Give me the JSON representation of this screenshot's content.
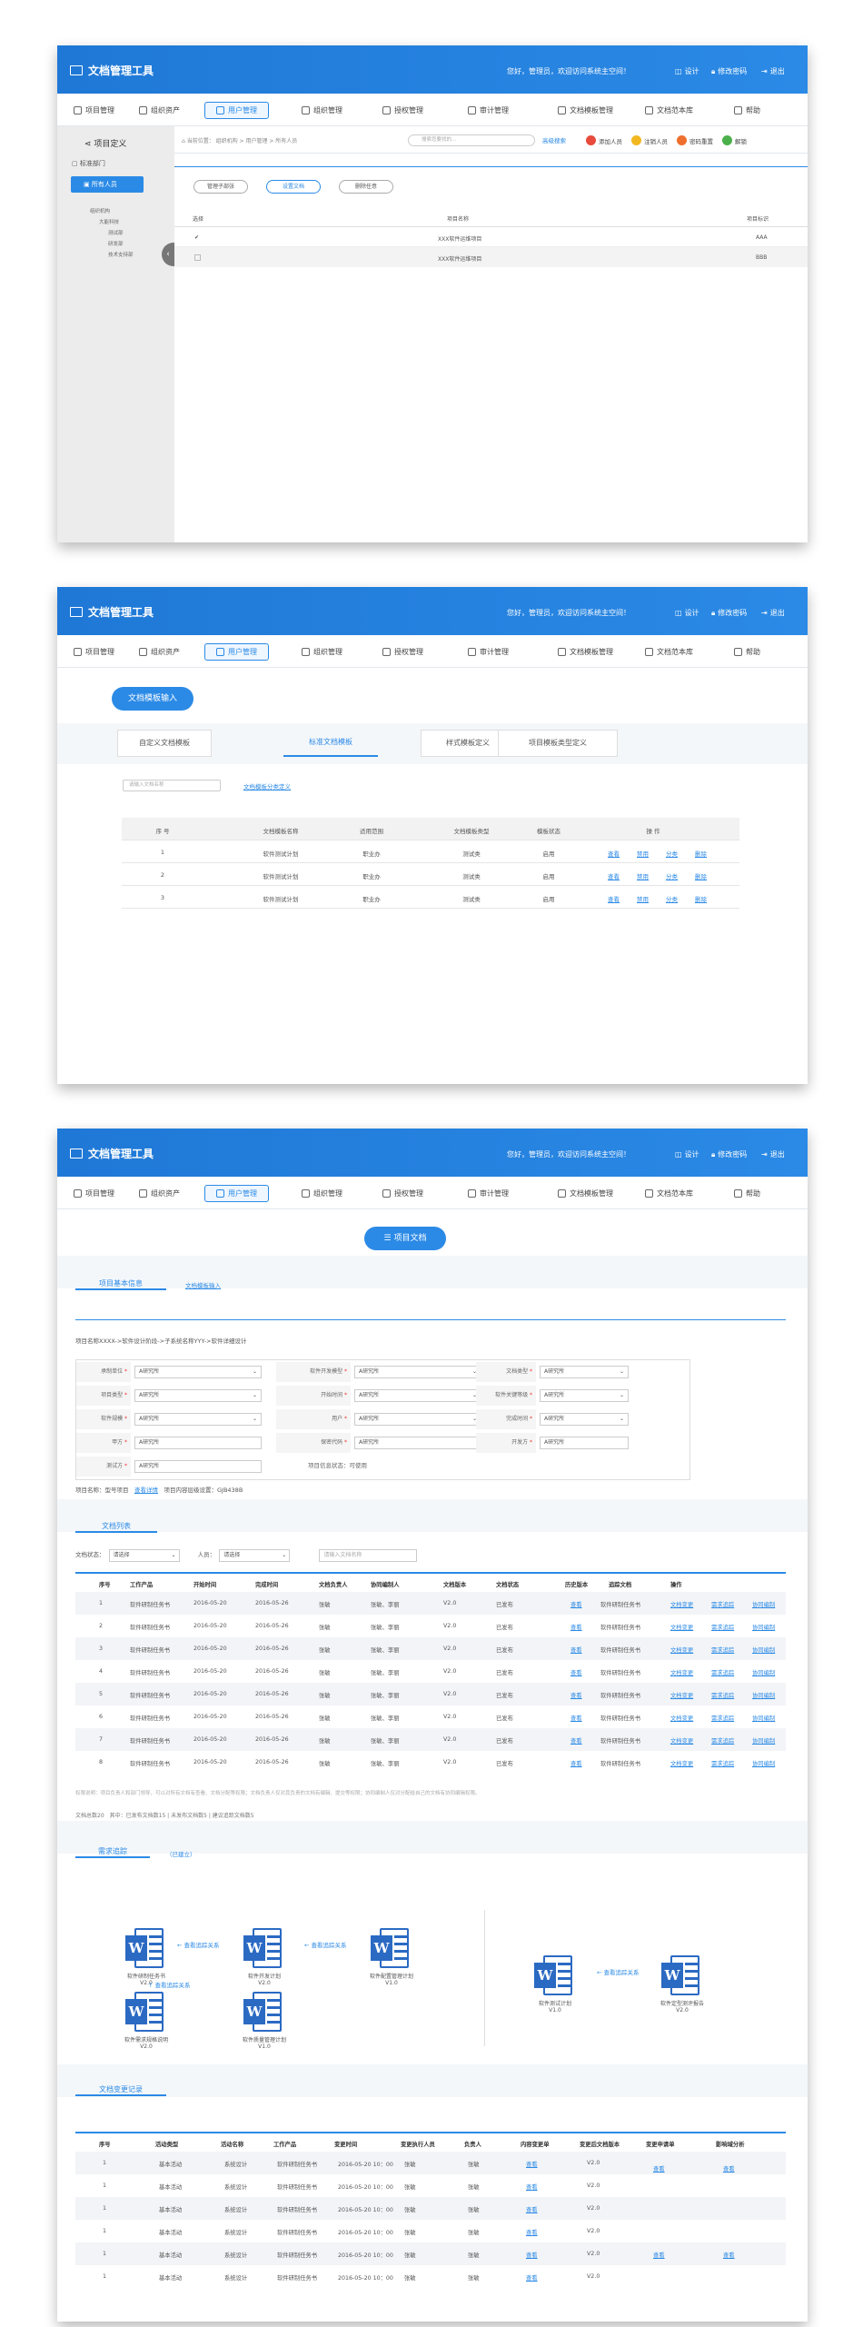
{
  "app": {
    "title": "文档管理工具",
    "welcome": "您好，管理员，欢迎访问系统主空间！",
    "top_links": [
      "设计",
      "修改密码",
      "退出"
    ]
  },
  "nav": [
    "项目管理",
    "组织资产",
    "用户管理",
    "组织管理",
    "授权管理",
    "审计管理",
    "文档模板管理",
    "文档范本库",
    "帮助"
  ],
  "p1": {
    "sidebar": {
      "title": "项目定义",
      "items": [
        "标准部门",
        "所有人员"
      ],
      "tree": [
        "组织机构",
        "大能科技",
        "测试部",
        "研发部",
        "技术支持部"
      ]
    },
    "crumb": "当前位置： 组织机构 > 用户管理 > 所有人员",
    "search_placeholder": "搜索您要找的...",
    "adv_search": "高级搜索",
    "actions": [
      "添加人员",
      "注销人员",
      "密码重置",
      "解锁"
    ],
    "pills": [
      "管理子部张",
      "设置文档",
      "删除任意"
    ],
    "headers": [
      "选择",
      "项目名称",
      "项目标识"
    ],
    "rows": [
      {
        "check": "✔",
        "name": "XXX软件运维项目",
        "id": "AAA"
      },
      {
        "check": "",
        "name": "XXX软件运维项目",
        "id": "BBB"
      }
    ]
  },
  "p2": {
    "title_btn": "文档模板输入",
    "tabs": [
      "自定义文档模板",
      "标准文档模板",
      "样式模板定义",
      "项目模板类型定义"
    ],
    "search_placeholder": "请输入文档名称",
    "link": "文档模板分类定义",
    "headers": [
      "序 号",
      "文档模板名称",
      "适用范围",
      "文档模板类型",
      "模板状态",
      "操 作"
    ],
    "rows": [
      {
        "n": "1",
        "name": "软件测试计划",
        "scope": "职业办",
        "type": "测试类",
        "status": "启用"
      },
      {
        "n": "2",
        "name": "软件测试计划",
        "scope": "职业办",
        "type": "测试类",
        "status": "启用"
      },
      {
        "n": "3",
        "name": "软件测试计划",
        "scope": "职业办",
        "type": "测试类",
        "status": "启用"
      }
    ],
    "ops": [
      "查看",
      "禁用",
      "分类",
      "删除"
    ]
  },
  "p3": {
    "title_btn": "项目文档",
    "sec1_tab": "项目基本信息",
    "sec1_link": "文档模板输入",
    "path": "项目名称XXXX->软件设计阶段->子系统名称YYY->软件详细设计",
    "form": [
      {
        "l": "承制单位",
        "v": "A研究所"
      },
      {
        "l": "软件开发模型",
        "v": "A研究所"
      },
      {
        "l": "文档类型",
        "v": "A研究所"
      },
      {
        "l": "项目类型",
        "v": "A研究所"
      },
      {
        "l": "开始时间",
        "v": "A研究所"
      },
      {
        "l": "软件关键等级",
        "v": "A研究所"
      },
      {
        "l": "软件规模",
        "v": "A研究所"
      },
      {
        "l": "用户",
        "v": "A研究所"
      },
      {
        "l": "完成时间",
        "v": "A研究所"
      },
      {
        "l": "甲方",
        "v": "A研究所"
      },
      {
        "l": "保密代码",
        "v": "A研究所"
      },
      {
        "l": "开发方",
        "v": "A研究所"
      },
      {
        "l": "测试方",
        "v": "A研究所"
      }
    ],
    "status_note": "项目信息状态：可使用",
    "info_line": [
      "项目名称：型号项目",
      "查看详情",
      "项目内容层级设置：GJB438B"
    ],
    "sec2": "文档列表",
    "filters": {
      "status_label": "文档状态：",
      "status_val": "请选择",
      "person_label": "人员：",
      "person_val": "请选择",
      "search": "请输入文档名称"
    },
    "headers": [
      "序号",
      "工作产品",
      "开始时间",
      "完成时间",
      "文档负责人",
      "协同编制人",
      "文档版本",
      "文档状态",
      "历史版本",
      "追踪文档",
      "操作"
    ],
    "doc_rows": [
      {
        "n": "1",
        "p": "软件研制任务书",
        "s": "2016-05-20",
        "e": "2016-05-26",
        "o": "张敏",
        "c": "张敏、李丽",
        "v": "V2.0",
        "st": "已发布"
      },
      {
        "n": "2",
        "p": "软件研制任务书",
        "s": "2016-05-20",
        "e": "2016-05-26",
        "o": "张敏",
        "c": "张敏、李丽",
        "v": "V2.0",
        "st": "已发布"
      },
      {
        "n": "3",
        "p": "软件研制任务书",
        "s": "2016-05-20",
        "e": "2016-05-26",
        "o": "张敏",
        "c": "张敏、李丽",
        "v": "V2.0",
        "st": "已发布"
      },
      {
        "n": "4",
        "p": "软件研制任务书",
        "s": "2016-05-20",
        "e": "2016-05-26",
        "o": "张敏",
        "c": "张敏、李丽",
        "v": "V2.0",
        "st": "已发布"
      },
      {
        "n": "5",
        "p": "软件研制任务书",
        "s": "2016-05-20",
        "e": "2016-05-26",
        "o": "张敏",
        "c": "张敏、李丽",
        "v": "V2.0",
        "st": "已发布"
      },
      {
        "n": "6",
        "p": "软件研制任务书",
        "s": "2016-05-20",
        "e": "2016-05-26",
        "o": "张敏",
        "c": "张敏、李丽",
        "v": "V2.0",
        "st": "已发布"
      },
      {
        "n": "7",
        "p": "软件研制任务书",
        "s": "2016-05-20",
        "e": "2016-05-26",
        "o": "张敏",
        "c": "张敏、李丽",
        "v": "V2.0",
        "st": "已发布"
      },
      {
        "n": "8",
        "p": "软件研制任务书",
        "s": "2016-05-20",
        "e": "2016-05-26",
        "o": "张敏",
        "c": "张敏、李丽",
        "v": "V2.0",
        "st": "已发布"
      }
    ],
    "doc_links": {
      "hist": "查看",
      "track": "软件研制任务书",
      "ops": [
        "文档变更",
        "需求追踪",
        "协同编制"
      ]
    },
    "note": "权限说明：项目负责人和部门领导，可以对所有文档有查看、文档分配等权限；文档负责人仅对其负责的文档有编辑、提交等权限；协同编制人仅对分配给自己的文档有协同编辑权限。",
    "summary": "文档总数20　其中：已发布文档数15 | 未发布文档数5 | 建议追踪文档数5",
    "sec3": "需求追踪",
    "sec3_sub": "（已建立）",
    "trace_link": "查看追踪关系",
    "trace_docs": [
      {
        "name": "软件研制任务书",
        "ver": "V2.0"
      },
      {
        "name": "软件开发计划",
        "ver": "V2.0"
      },
      {
        "name": "软件配置管理计划",
        "ver": "V1.0"
      },
      {
        "name": "软件需求规格说明",
        "ver": "V2.0"
      },
      {
        "name": "软件质量管理计划",
        "ver": "V1.0"
      },
      {
        "name": "软件测试计划",
        "ver": "V1.0"
      },
      {
        "name": "软件定型测评报告",
        "ver": "V2.0"
      }
    ],
    "sec4": "文档变更记录",
    "ch_headers": [
      "序号",
      "活动类型",
      "活动名称",
      "工作产品",
      "变更时间",
      "变更执行人员",
      "负责人",
      "内容变更单",
      "变更后文档版本",
      "变更申请单",
      "影响域分析"
    ],
    "ch_rows": [
      {
        "n": "1",
        "t": "基本活动",
        "a": "系统设计",
        "p": "软件研制任务书",
        "time": "2016-05-20 10：00",
        "u": "张敏",
        "o": "张敏",
        "v": "V2.0"
      },
      {
        "n": "1",
        "t": "基本活动",
        "a": "系统设计",
        "p": "软件研制任务书",
        "time": "2016-05-20 10：00",
        "u": "张敏",
        "o": "张敏",
        "v": "V2.0"
      },
      {
        "n": "1",
        "t": "基本活动",
        "a": "系统设计",
        "p": "软件研制任务书",
        "time": "2016-05-20 10：00",
        "u": "张敏",
        "o": "张敏",
        "v": "V2.0"
      },
      {
        "n": "1",
        "t": "基本活动",
        "a": "系统设计",
        "p": "软件研制任务书",
        "time": "2016-05-20 10：00",
        "u": "张敏",
        "o": "张敏",
        "v": "V2.0"
      },
      {
        "n": "1",
        "t": "基本活动",
        "a": "系统设计",
        "p": "软件研制任务书",
        "time": "2016-05-20 10：00",
        "u": "张敏",
        "o": "张敏",
        "v": "V2.0"
      },
      {
        "n": "1",
        "t": "基本活动",
        "a": "系统设计",
        "p": "软件研制任务书",
        "time": "2016-05-20 10：00",
        "u": "张敏",
        "o": "张敏",
        "v": "V2.0"
      }
    ],
    "view": "查看"
  }
}
